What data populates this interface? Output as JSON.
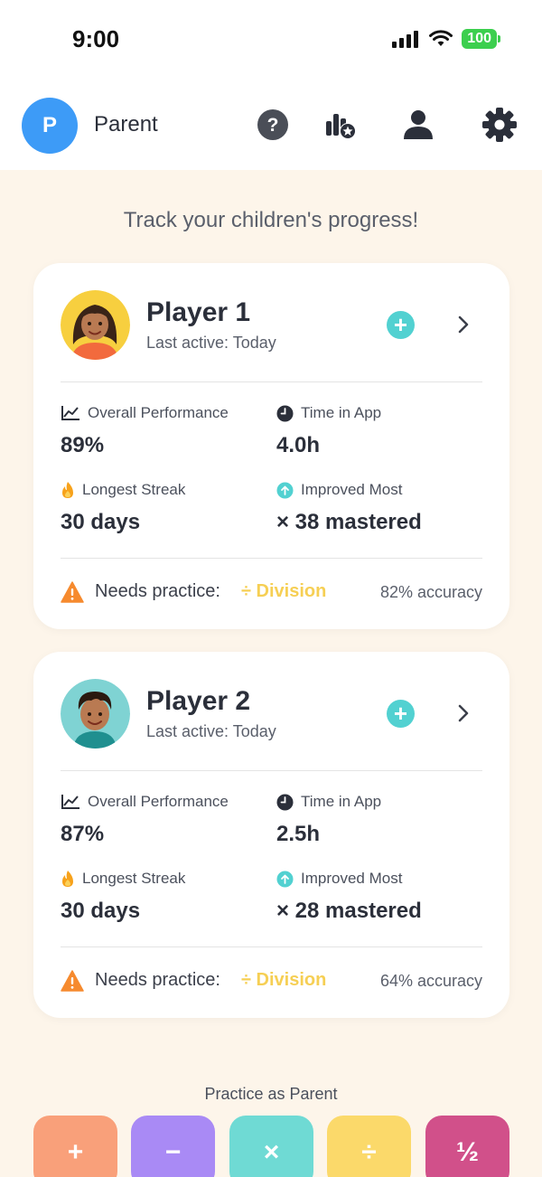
{
  "status_bar": {
    "time": "9:00",
    "battery": "100",
    "icons": [
      "signal-icon",
      "wifi-icon",
      "battery-icon"
    ]
  },
  "header": {
    "avatar_initial": "P",
    "name": "Parent",
    "icons": [
      "help-icon",
      "leaderboard-icon",
      "profile-icon",
      "settings-icon"
    ]
  },
  "tagline": "Track your children's progress!",
  "players": [
    {
      "name": "Player 1",
      "last_active": "Last active: Today",
      "add_label": "+",
      "stats": {
        "overall_label": "Overall Performance",
        "overall_value": "89%",
        "time_label": "Time in App",
        "time_value": "4.0h",
        "streak_label": "Longest Streak",
        "streak_value": "30 days",
        "improved_label": "Improved Most",
        "improved_value": "× 38 mastered"
      },
      "needs_practice": {
        "label": "Needs practice:",
        "topic": "÷ Division",
        "accuracy": "82% accuracy"
      },
      "avatar_colors": {
        "bg": "#f7cf3f",
        "shirt": "#f26a3d"
      }
    },
    {
      "name": "Player 2",
      "last_active": "Last active: Today",
      "add_label": "+",
      "stats": {
        "overall_label": "Overall Performance",
        "overall_value": "87%",
        "time_label": "Time in App",
        "time_value": "2.5h",
        "streak_label": "Longest Streak",
        "streak_value": "30 days",
        "improved_label": "Improved Most",
        "improved_value": "× 28 mastered"
      },
      "needs_practice": {
        "label": "Needs practice:",
        "topic": "÷ Division",
        "accuracy": "64% accuracy"
      },
      "avatar_colors": {
        "bg": "#7fd3d3",
        "shirt": "#1f8f8f"
      }
    }
  ],
  "practice": {
    "title": "Practice as Parent",
    "buttons": [
      {
        "label": "+",
        "color": "#f9a07a"
      },
      {
        "label": "−",
        "color": "#a98af5"
      },
      {
        "label": "×",
        "color": "#6fdad4"
      },
      {
        "label": "÷",
        "color": "#fbd96a"
      },
      {
        "label": "½",
        "color": "#d1508a"
      }
    ]
  },
  "colors": {
    "accent_teal": "#52d1d1",
    "avatar_blue": "#3d9bf7",
    "warning_orange": "#f68a2e",
    "division_yellow": "#f6cf54",
    "background": "#fdf5ea"
  }
}
